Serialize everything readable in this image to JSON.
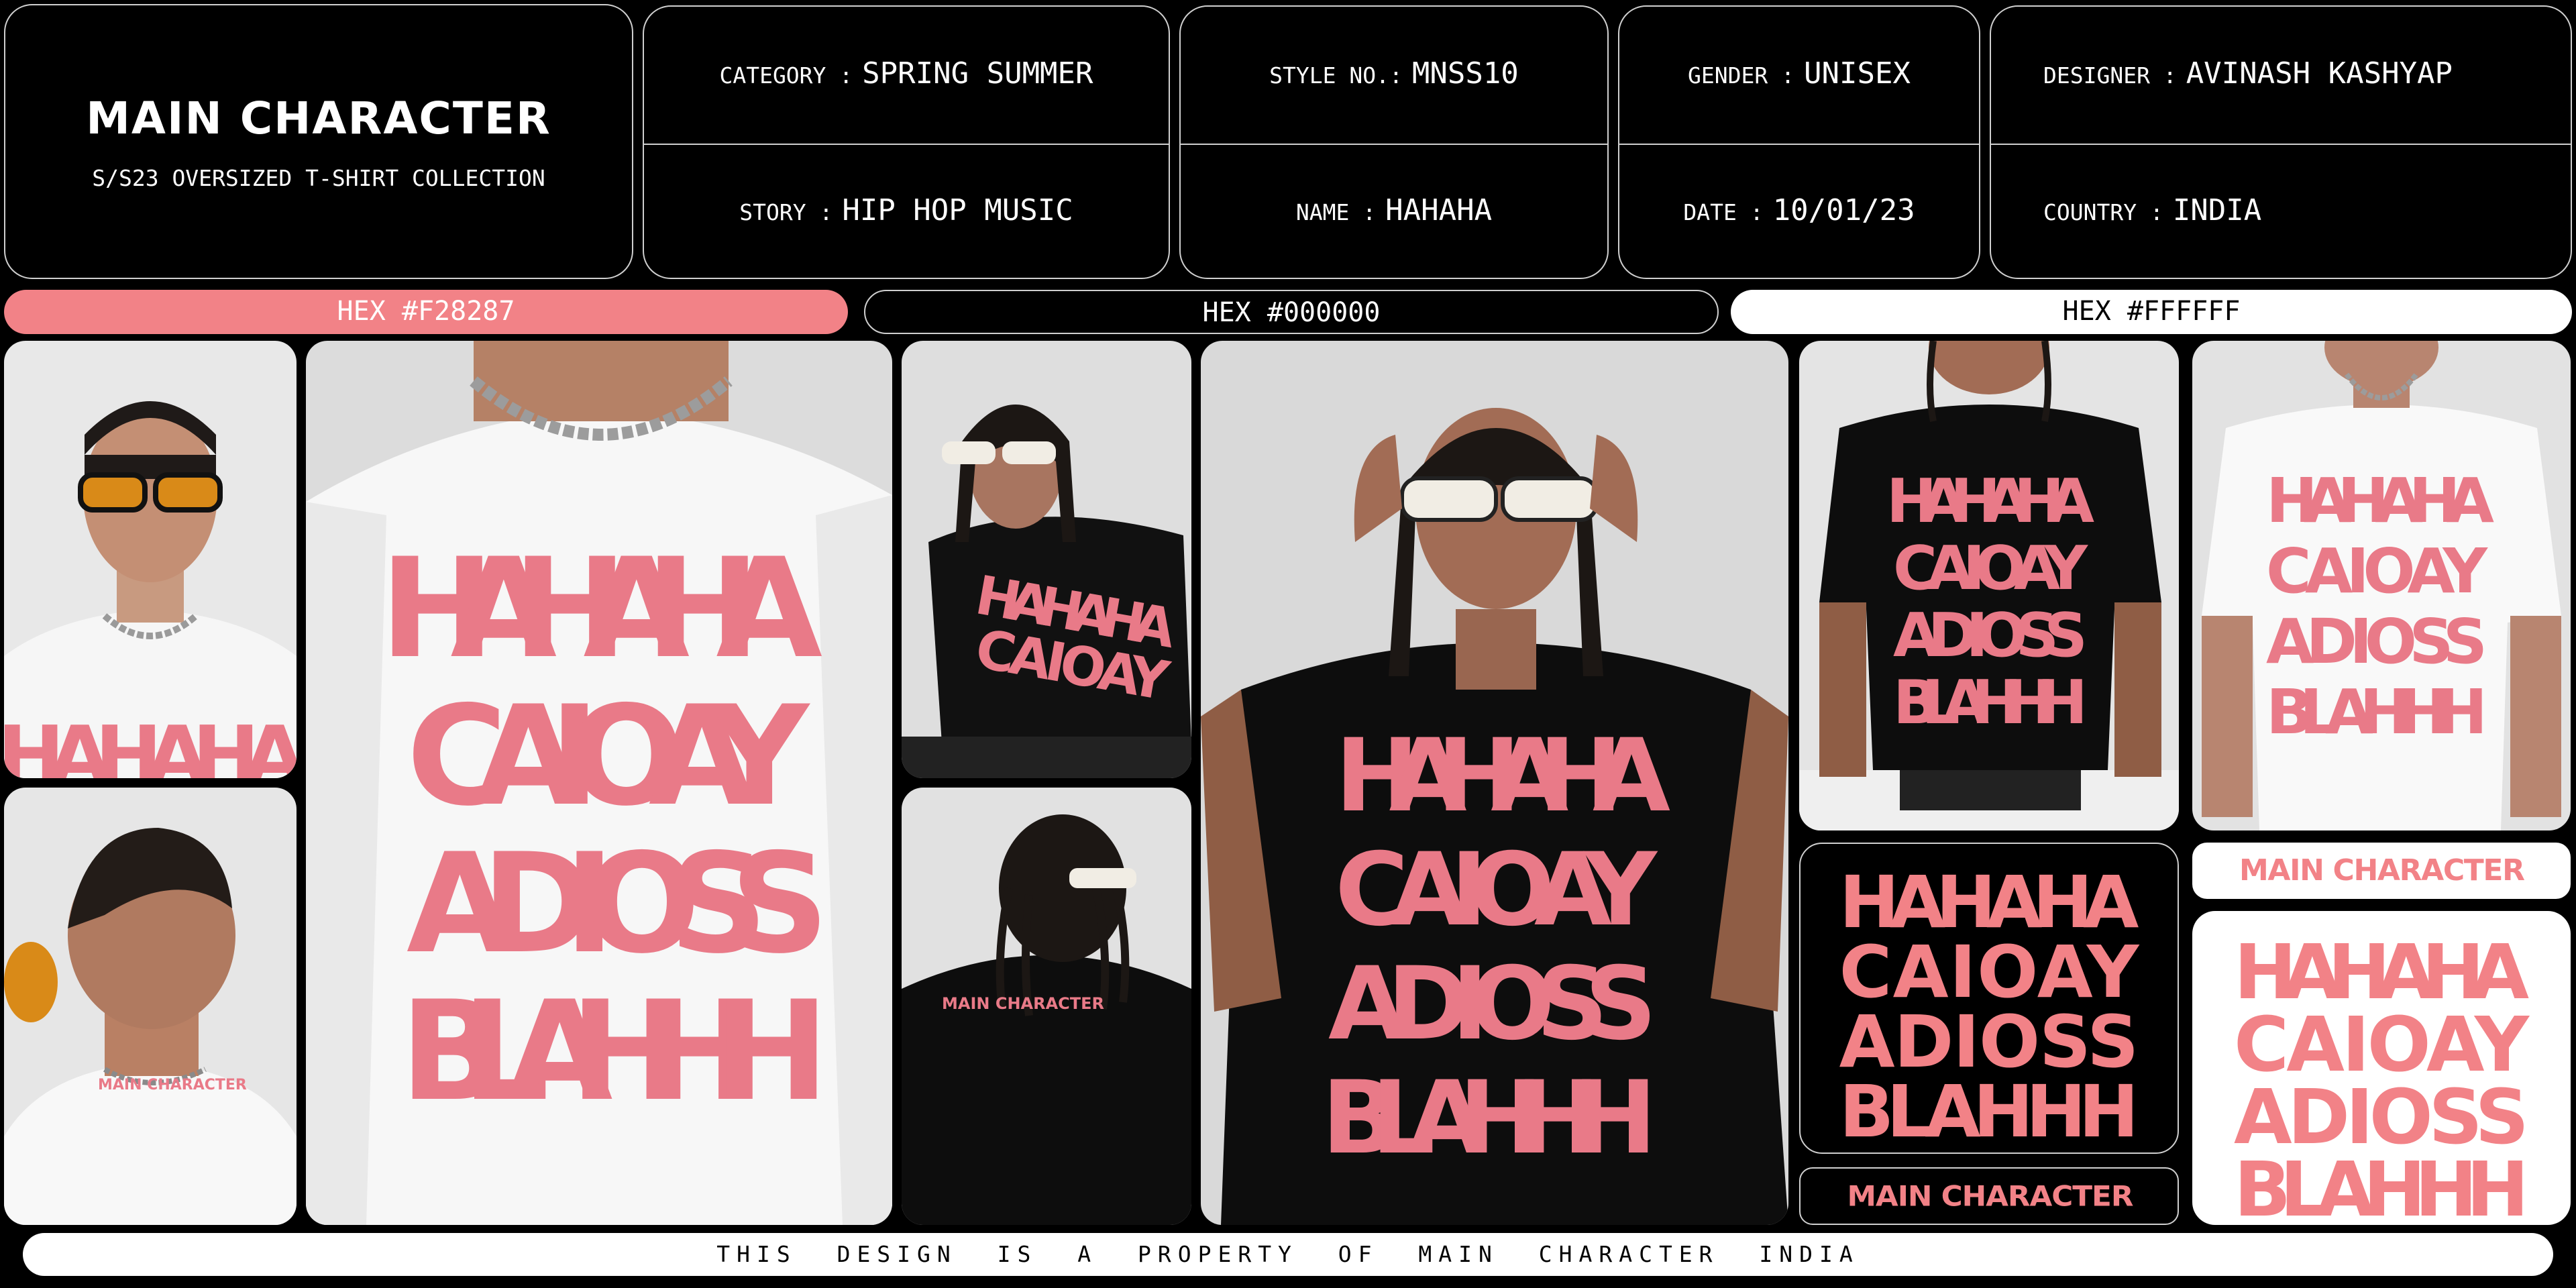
{
  "header": {
    "brand": "MAIN CHARACTER",
    "subtitle": "S/S23 OVERSIZED T-SHIRT COLLECTION",
    "fields": {
      "category": {
        "label": "CATEGORY :",
        "value": "SPRING SUMMER"
      },
      "story": {
        "label": "STORY :",
        "value": "HIP HOP MUSIC"
      },
      "style_no": {
        "label": "STYLE NO.:",
        "value": "MNSS10"
      },
      "name": {
        "label": "NAME :",
        "value": "HAHAHA"
      },
      "gender": {
        "label": "GENDER :",
        "value": "UNISEX"
      },
      "date": {
        "label": "DATE :",
        "value": "10/01/23"
      },
      "designer": {
        "label": "DESIGNER :",
        "value": "AVINASH KASHYAP"
      },
      "country": {
        "label": "COUNTRY :",
        "value": "INDIA"
      }
    }
  },
  "swatches": [
    {
      "label": "HEX #F28287",
      "color": "#F28287"
    },
    {
      "label": "HEX #000000",
      "color": "#000000"
    },
    {
      "label": "HEX #FFFFFF",
      "color": "#FFFFFF"
    }
  ],
  "artwork": {
    "lines": [
      "HAHAHA",
      "CAIOAY",
      "ADIOSS",
      "BLAHHH"
    ],
    "label": "MAIN CHARACTER"
  },
  "footer": "THIS DESIGN IS A PROPERTY OF MAIN CHARACTER INDIA",
  "colors": {
    "pink": "#F28287",
    "print_pink": "#E97A88",
    "black": "#000000",
    "white": "#FFFFFF",
    "backdrop": "#DADADA"
  }
}
